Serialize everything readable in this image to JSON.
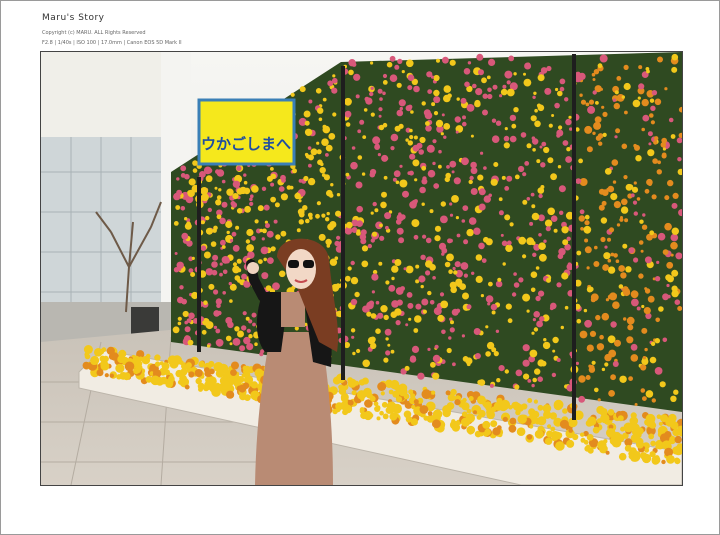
{
  "header": {
    "title": "Maru's Story",
    "copyright": "Copyright (c) MARU. ALL Rights Reserved",
    "exif": "F2.8 | 1/40s | ISO 100 | 17.0mm | Canon EOS 5D Mark II"
  },
  "photo": {
    "sign_text": "ウかごしまへ",
    "colors": {
      "sign_bg": "#f5e81c",
      "sign_border": "#3a7fb6",
      "sign_text": "#1f4ea1",
      "yellow_flower": "#f2c81b",
      "pink_flower": "#d8587a",
      "orange_flower": "#e38b1e",
      "foliage": "#2f4a21"
    }
  }
}
